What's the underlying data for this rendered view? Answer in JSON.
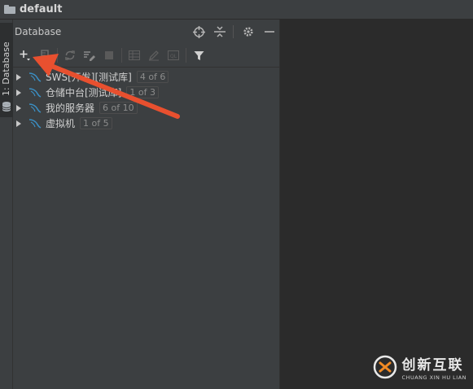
{
  "window": {
    "title": "default"
  },
  "sidebar_tab": {
    "label": "1: Database"
  },
  "panel": {
    "title": "Database",
    "header_icons": [
      "crosshair-icon",
      "collapse-icon",
      "gear-icon",
      "minimize-icon"
    ],
    "toolbar_icons": [
      "add-icon",
      "duplicate-icon",
      "refresh-icon",
      "properties-icon",
      "stop-icon",
      "table-icon",
      "edit-icon",
      "console-icon",
      "filter-icon"
    ]
  },
  "tree": [
    {
      "name": "SWS[开发][测试库]",
      "count": "4 of 6"
    },
    {
      "name": "仓储中台[测试库]",
      "count": "1 of 3"
    },
    {
      "name": "我的服务器",
      "count": "6 of 10"
    },
    {
      "name": "虚拟机",
      "count": "1 of 5"
    }
  ],
  "annotation": {
    "color": "#e8502f"
  },
  "watermark": {
    "cn": "创新互联",
    "en": "CHUANG XIN HU LIAN"
  }
}
